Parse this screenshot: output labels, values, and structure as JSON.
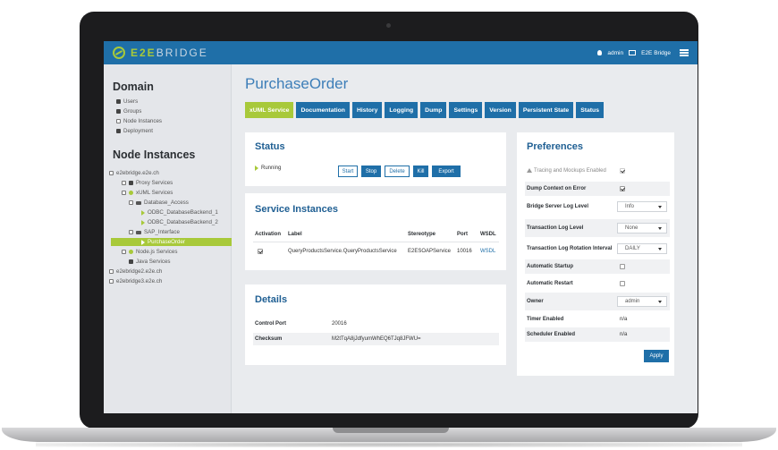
{
  "app": {
    "logo_bold": "E2E",
    "logo_thin": "BRIDGE",
    "user": "admin",
    "instance": "E2E Bridge"
  },
  "sidebar": {
    "domain_title": "Domain",
    "domain_items": [
      {
        "label": "Users",
        "icon": "user-icon"
      },
      {
        "label": "Groups",
        "icon": "group-icon"
      },
      {
        "label": "Node Instances",
        "icon": "monitor-icon"
      },
      {
        "label": "Deployment",
        "icon": "deployment-icon"
      }
    ],
    "node_title": "Node Instances",
    "tree": [
      "e2ebridge.e2e.ch",
      "Proxy Services",
      "xUML Services",
      "Database_Access",
      "ODBC_DatabaseBackend_1",
      "ODBC_DatabaseBackend_2",
      "SAP_Interface",
      "PurchaseOrder",
      "Node.js Services",
      "Java Services",
      "e2ebridge2.e2e.ch",
      "e2ebridge3.e2e.ch"
    ]
  },
  "main": {
    "title": "PurchaseOrder",
    "tabs": [
      "xUML Service",
      "Documentation",
      "History",
      "Logging",
      "Dump",
      "Settings",
      "Version",
      "Persistent State",
      "Status"
    ],
    "active_tab": "xUML Service"
  },
  "status": {
    "title": "Status",
    "state": "Running",
    "buttons": [
      "Start",
      "Stop",
      "Delete",
      "Kill",
      "Export"
    ]
  },
  "service_instances": {
    "title": "Service Instances",
    "columns": [
      "Activation",
      "Label",
      "Stereotype",
      "Port",
      "WSDL"
    ],
    "rows": [
      {
        "label": "QueryProductsService.QueryProductsService",
        "stereotype": "E2ESOAPService",
        "port": "10016",
        "wsdl": "WSDL"
      }
    ]
  },
  "details": {
    "title": "Details",
    "rows": [
      {
        "key": "Control Port",
        "value": "20016"
      },
      {
        "key": "Checksum",
        "value": "M2tTqA8jJdfyumWhEQ6TJq8JFWU="
      }
    ]
  },
  "preferences": {
    "title": "Preferences",
    "rows": [
      {
        "label": "Tracing and Mockups Enabled"
      },
      {
        "label": "Dump Context on Error"
      },
      {
        "label": "Bridge Server Log Level",
        "value": "Info"
      },
      {
        "label": "Transaction Log Level",
        "value": "None"
      },
      {
        "label": "Transaction Log Rotation Interval",
        "value": "DAILY"
      },
      {
        "label": "Automatic Startup"
      },
      {
        "label": "Automatic Restart"
      },
      {
        "label": "Owner",
        "value": "admin"
      },
      {
        "label": "Timer Enabled",
        "value": "n/a"
      },
      {
        "label": "Scheduler Enabled",
        "value": "n/a"
      }
    ],
    "apply_label": "Apply"
  },
  "colors": {
    "accent_green": "#a8c93a",
    "primary_blue": "#1f6fa8",
    "title_blue": "#3d7eb8"
  }
}
